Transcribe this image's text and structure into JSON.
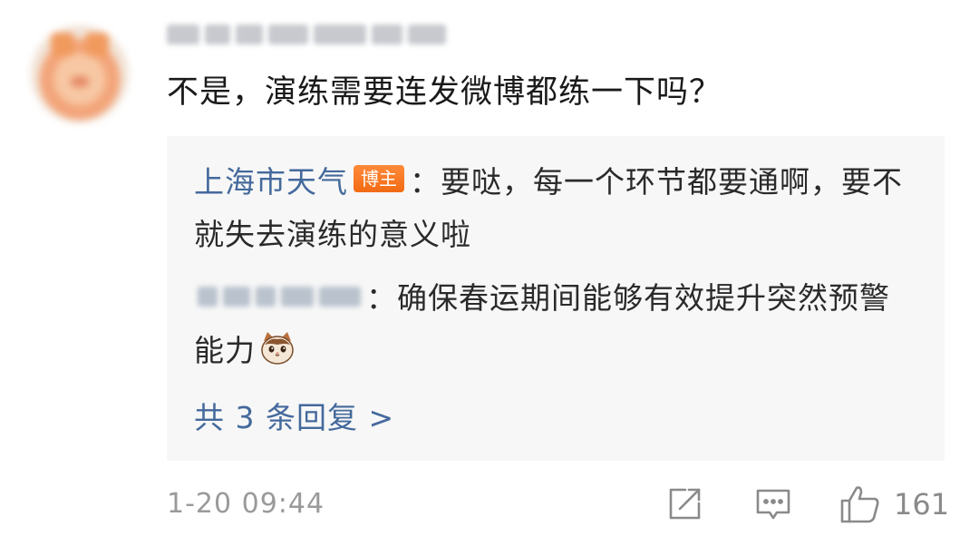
{
  "comment": {
    "text": "不是，演练需要连发微博都练一下吗？",
    "timestamp": "1-20 09:44",
    "like_count": "161"
  },
  "replies": [
    {
      "author": "上海市天气",
      "badge": "博主",
      "text": "：要哒，每一个环节都要通啊，要不就失去演练的意义啦"
    },
    {
      "text": "：确保春运期间能够有效提升突然预警能力",
      "emoji": "cat-face-emoji"
    }
  ],
  "more_replies": "共 3 条回复 >",
  "icons": {
    "share": "share-icon",
    "comment": "comment-icon",
    "like": "thumbs-up-icon"
  },
  "colors": {
    "link": "#44699c",
    "badge": "#f26a14",
    "muted": "#9a9a9a",
    "reply_bg": "#f7f7f7"
  }
}
